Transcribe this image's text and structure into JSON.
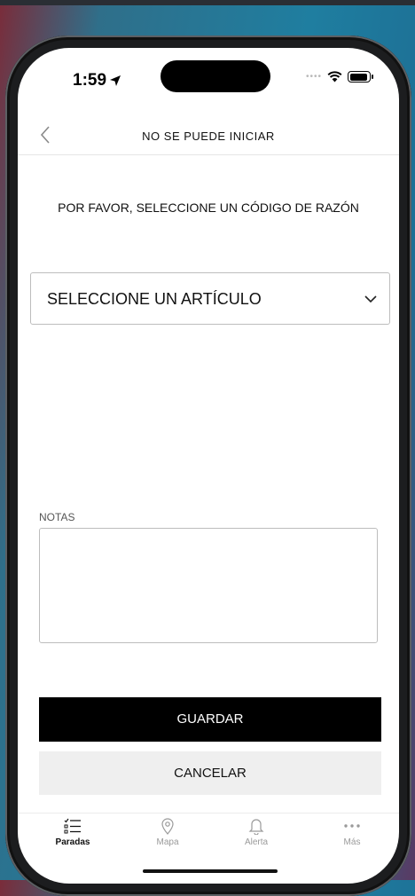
{
  "status": {
    "time": "1:59"
  },
  "nav": {
    "title": "NO SE PUEDE INICIAR"
  },
  "prompt": "POR FAVOR, SELECCIONE UN CÓDIGO DE RAZÓN",
  "reason_select": {
    "selected": "SELECCIONE UN ARTÍCULO"
  },
  "notes": {
    "label": "NOTAS",
    "value": ""
  },
  "buttons": {
    "save": "GUARDAR",
    "cancel": "CANCELAR"
  },
  "tabs": [
    {
      "label": "Paradas",
      "icon": "checklist-icon",
      "active": true
    },
    {
      "label": "Mapa",
      "icon": "map-pin-icon",
      "active": false
    },
    {
      "label": "Alerta",
      "icon": "bell-icon",
      "active": false
    },
    {
      "label": "Más",
      "icon": "more-icon",
      "active": false
    }
  ],
  "colors": {
    "primary_button": "#000000",
    "secondary_button": "#efefef",
    "inactive_tab": "#9a9a9a"
  }
}
